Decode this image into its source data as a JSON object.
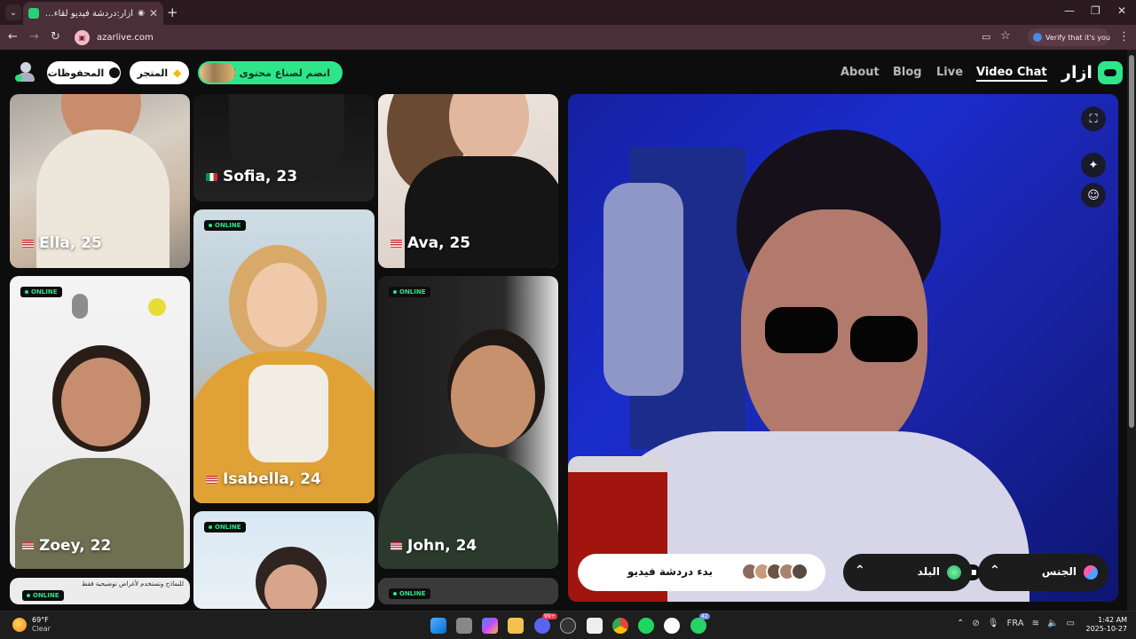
{
  "browser": {
    "tab_title": "أزار:دردشة فيديو لقاء الأصدقاء",
    "tab_close": "✕",
    "new_tab": "+",
    "url": "azarlive.com",
    "verify_chip": "Verify that it's you",
    "window_controls": [
      "—",
      "❐",
      "✕"
    ]
  },
  "header": {
    "saved_label": "المحفوظات",
    "store_label": "المتجر",
    "creator_label": "انضم لصناع محتوى ازار",
    "nav": {
      "about": "About",
      "blog": "Blog",
      "live": "Live",
      "video_chat": "Video Chat"
    },
    "logo_text": "ازار",
    "accent_color": "#2ee58a"
  },
  "profiles": {
    "online_label": "ONLINE",
    "cards": [
      {
        "name": "Ella, 25",
        "flag": "us"
      },
      {
        "name": "Sofia, 23",
        "flag": "it"
      },
      {
        "name": "Ava, 25",
        "flag": "us"
      },
      {
        "name": "Isabella, 24",
        "flag": "us"
      },
      {
        "name": "Zoey, 22",
        "flag": "us"
      },
      {
        "name": "John, 24",
        "flag": "us"
      }
    ],
    "disclaimer": "للنماذج وتستخدم لأغراض توضيحية فقط"
  },
  "controls": {
    "start_chat_label": "بدء دردشة فيديو",
    "country_label": "البلد",
    "gender_label": "الجنس",
    "chevron": "⌃"
  },
  "taskbar": {
    "temperature": "69°F",
    "condition": "Clear",
    "language": "FRA",
    "time": "1:42 AM",
    "date": "2025-10-27",
    "badges": {
      "discord": "99+",
      "whatsapp": "42"
    }
  }
}
